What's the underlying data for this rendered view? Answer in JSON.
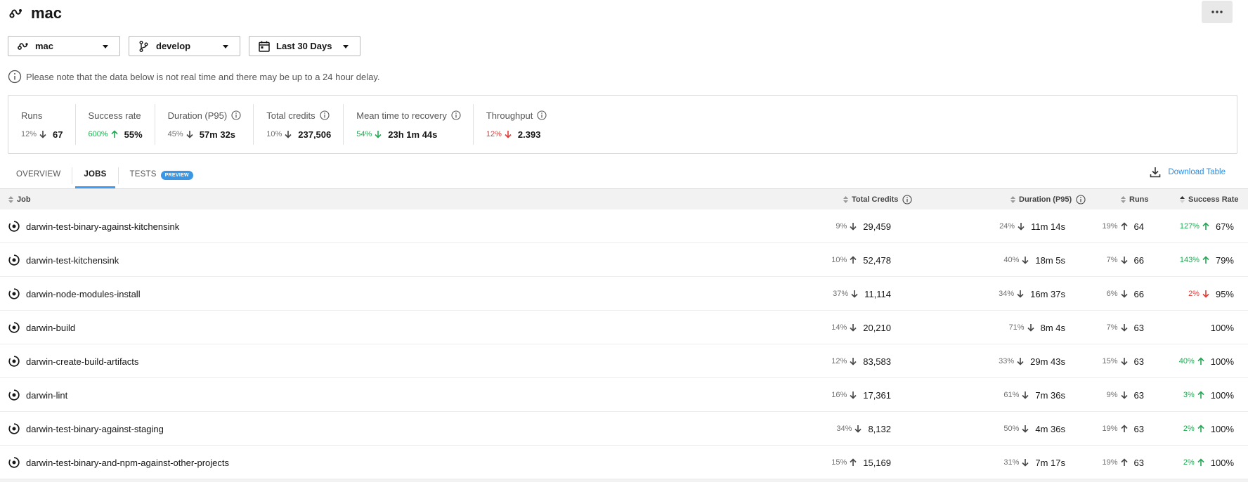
{
  "header": {
    "title": "mac",
    "icon": "workflow-icon",
    "more_icon": "more-icon"
  },
  "filters": {
    "workflow": {
      "label": "mac",
      "icon": "workflow-icon"
    },
    "branch": {
      "label": "develop",
      "icon": "branch-icon"
    },
    "range": {
      "label": "Last 30 Days",
      "icon": "calendar-icon"
    }
  },
  "notice": "Please note that the data below is not real time and there may be up to a 24 hour delay.",
  "metrics": [
    {
      "label": "Runs",
      "pct": "12%",
      "trend": "down",
      "color": "gray",
      "value": "67",
      "info": false
    },
    {
      "label": "Success rate",
      "pct": "600%",
      "trend": "up",
      "color": "green",
      "value": "55%",
      "info": false
    },
    {
      "label": "Duration (P95)",
      "pct": "45%",
      "trend": "down",
      "color": "gray",
      "value": "57m 32s",
      "info": true
    },
    {
      "label": "Total credits",
      "pct": "10%",
      "trend": "down",
      "color": "gray",
      "value": "237,506",
      "info": true
    },
    {
      "label": "Mean time to recovery",
      "pct": "54%",
      "trend": "down",
      "color": "green",
      "value": "23h 1m 44s",
      "info": true
    },
    {
      "label": "Throughput",
      "pct": "12%",
      "trend": "down",
      "color": "red",
      "value": "2.393",
      "info": true
    }
  ],
  "tabs": {
    "overview": "OVERVIEW",
    "jobs": "JOBS",
    "tests": "TESTS",
    "tests_badge": "PREVIEW",
    "active": "jobs"
  },
  "download_label": "Download Table",
  "table": {
    "columns": {
      "job": "Job",
      "credits": "Total Credits",
      "duration": "Duration (P95)",
      "runs": "Runs",
      "success": "Success Rate"
    },
    "rows": [
      {
        "job": "darwin-test-binary-against-kitchensink",
        "credits": {
          "pct": "9%",
          "trend": "down",
          "color": "gray",
          "value": "29,459"
        },
        "duration": {
          "pct": "24%",
          "trend": "down",
          "color": "gray",
          "value": "11m 14s"
        },
        "runs": {
          "pct": "19%",
          "trend": "up",
          "color": "gray",
          "value": "64"
        },
        "success": {
          "pct": "127%",
          "trend": "up",
          "color": "green",
          "value": "67%"
        }
      },
      {
        "job": "darwin-test-kitchensink",
        "credits": {
          "pct": "10%",
          "trend": "up",
          "color": "gray",
          "value": "52,478"
        },
        "duration": {
          "pct": "40%",
          "trend": "down",
          "color": "gray",
          "value": "18m 5s"
        },
        "runs": {
          "pct": "7%",
          "trend": "down",
          "color": "gray",
          "value": "66"
        },
        "success": {
          "pct": "143%",
          "trend": "up",
          "color": "green",
          "value": "79%"
        }
      },
      {
        "job": "darwin-node-modules-install",
        "credits": {
          "pct": "37%",
          "trend": "down",
          "color": "gray",
          "value": "11,114"
        },
        "duration": {
          "pct": "34%",
          "trend": "down",
          "color": "gray",
          "value": "16m 37s"
        },
        "runs": {
          "pct": "6%",
          "trend": "down",
          "color": "gray",
          "value": "66"
        },
        "success": {
          "pct": "2%",
          "trend": "down",
          "color": "red",
          "value": "95%"
        }
      },
      {
        "job": "darwin-build",
        "credits": {
          "pct": "14%",
          "trend": "down",
          "color": "gray",
          "value": "20,210"
        },
        "duration": {
          "pct": "71%",
          "trend": "down",
          "color": "gray",
          "value": "8m 4s"
        },
        "runs": {
          "pct": "7%",
          "trend": "down",
          "color": "gray",
          "value": "63"
        },
        "success": {
          "pct": "",
          "trend": "none",
          "color": "gray",
          "value": "100%"
        }
      },
      {
        "job": "darwin-create-build-artifacts",
        "credits": {
          "pct": "12%",
          "trend": "down",
          "color": "gray",
          "value": "83,583"
        },
        "duration": {
          "pct": "33%",
          "trend": "down",
          "color": "gray",
          "value": "29m 43s"
        },
        "runs": {
          "pct": "15%",
          "trend": "down",
          "color": "gray",
          "value": "63"
        },
        "success": {
          "pct": "40%",
          "trend": "up",
          "color": "green",
          "value": "100%"
        }
      },
      {
        "job": "darwin-lint",
        "credits": {
          "pct": "16%",
          "trend": "down",
          "color": "gray",
          "value": "17,361"
        },
        "duration": {
          "pct": "61%",
          "trend": "down",
          "color": "gray",
          "value": "7m 36s"
        },
        "runs": {
          "pct": "9%",
          "trend": "down",
          "color": "gray",
          "value": "63"
        },
        "success": {
          "pct": "3%",
          "trend": "up",
          "color": "green",
          "value": "100%"
        }
      },
      {
        "job": "darwin-test-binary-against-staging",
        "credits": {
          "pct": "34%",
          "trend": "down",
          "color": "gray",
          "value": "8,132"
        },
        "duration": {
          "pct": "50%",
          "trend": "down",
          "color": "gray",
          "value": "4m 36s"
        },
        "runs": {
          "pct": "19%",
          "trend": "up",
          "color": "gray",
          "value": "63"
        },
        "success": {
          "pct": "2%",
          "trend": "up",
          "color": "green",
          "value": "100%"
        }
      },
      {
        "job": "darwin-test-binary-and-npm-against-other-projects",
        "credits": {
          "pct": "15%",
          "trend": "up",
          "color": "gray",
          "value": "15,169"
        },
        "duration": {
          "pct": "31%",
          "trend": "down",
          "color": "gray",
          "value": "7m 17s"
        },
        "runs": {
          "pct": "19%",
          "trend": "up",
          "color": "gray",
          "value": "63"
        },
        "success": {
          "pct": "2%",
          "trend": "up",
          "color": "green",
          "value": "100%"
        }
      }
    ]
  },
  "colors": {
    "accent": "#3b9ef5",
    "link": "#2d8fe0",
    "green": "#1fa851",
    "red": "#e53935",
    "badge": "#3b97e3"
  }
}
